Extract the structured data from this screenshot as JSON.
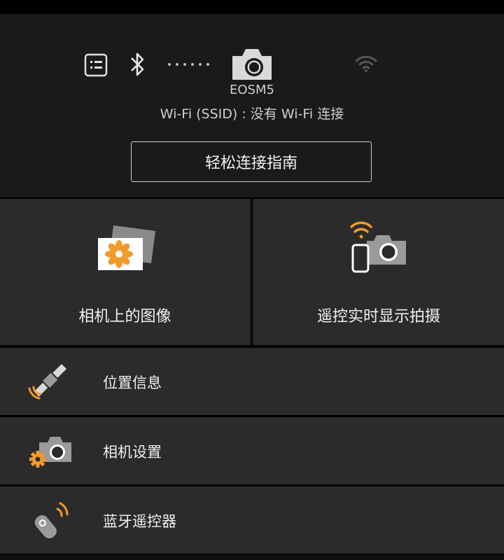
{
  "header": {
    "camera_model": "EOSM5",
    "wifi_ssid": "Wi-Fi (SSID) : 没有 Wi-Fi 连接",
    "guide_button_label": "轻松连接指南"
  },
  "tiles": [
    {
      "label": "相机上的图像",
      "icon": "images-on-camera-icon"
    },
    {
      "label": "遥控实时显示拍摄",
      "icon": "remote-live-view-icon"
    }
  ],
  "menu": [
    {
      "label": "位置信息",
      "icon": "satellite-icon"
    },
    {
      "label": "相机设置",
      "icon": "camera-settings-icon"
    },
    {
      "label": "蓝牙遥控器",
      "icon": "bluetooth-remote-icon"
    }
  ],
  "colors": {
    "accent_orange": "#f39a2c",
    "icon_gray": "#bdbdbd",
    "tile_bg": "#2b2b2b",
    "header_bg": "#1a1a1a"
  }
}
